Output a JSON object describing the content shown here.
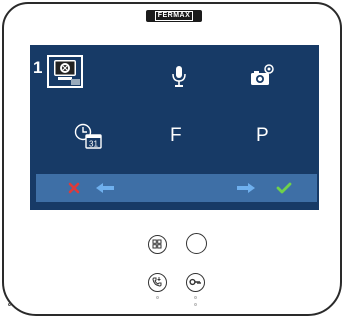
{
  "brand": {
    "label": "FERMAX"
  },
  "screen": {
    "page_number": "1",
    "menu": [
      {
        "name": "monitor-settings",
        "icon": "monitor-settings-icon",
        "selected": true
      },
      {
        "name": "microphone",
        "icon": "microphone-icon",
        "selected": false
      },
      {
        "name": "camera-settings",
        "icon": "camera-settings-icon",
        "selected": false
      },
      {
        "name": "date-time",
        "icon": "clock-calendar-icon",
        "label": "31"
      },
      {
        "name": "f-option",
        "label": "F"
      },
      {
        "name": "p-option",
        "label": "P"
      }
    ],
    "navbar": {
      "cancel": "cancel-icon",
      "left": "arrow-left-icon",
      "right": "arrow-right-icon",
      "confirm": "checkmark-icon"
    }
  },
  "colors": {
    "screen_bg": "#173a66",
    "navbar_bg": "#3e6fa6",
    "cancel": "#e03a3a",
    "arrows": "#5aa0e6",
    "confirm": "#6fd24a"
  }
}
